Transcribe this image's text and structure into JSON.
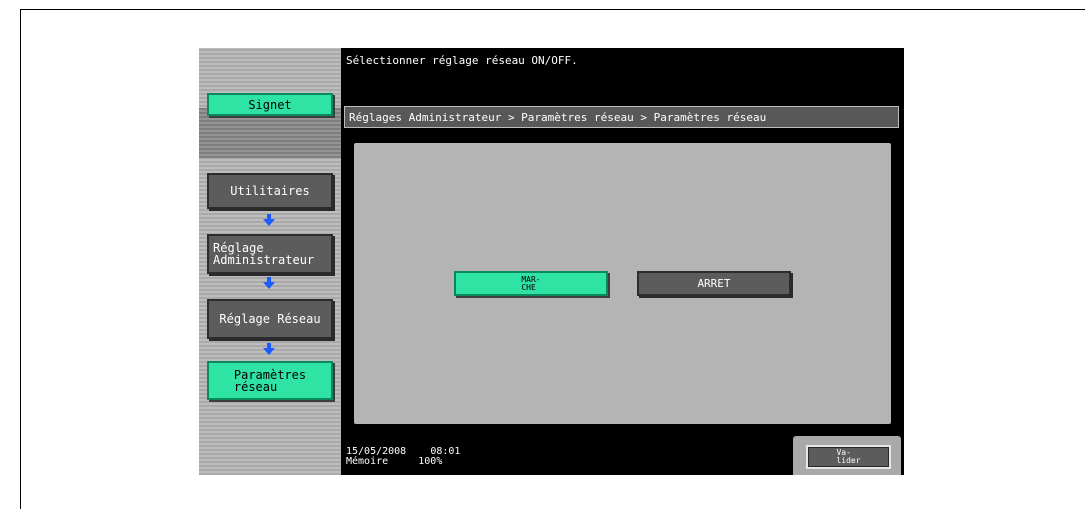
{
  "message": "Sélectionner réglage réseau ON/OFF.",
  "sidebar": {
    "bookmark_label": "Signet",
    "steps": [
      {
        "label": "Utilitaires",
        "active": false
      },
      {
        "label": "Réglage\nAdministrateur",
        "active": false
      },
      {
        "label": "Réglage Réseau",
        "active": false
      },
      {
        "label": "Paramètres\nréseau",
        "active": true
      }
    ]
  },
  "breadcrumb": "Réglages Administrateur > Paramètres réseau > Paramètres réseau",
  "options": {
    "on_label": "MAR-\nCHE",
    "off_label": "ARRET",
    "selected": "on"
  },
  "status": {
    "date": "15/05/2008",
    "time": "08:01",
    "memory_label": "Mémoire",
    "memory_value": "100%"
  },
  "valider_label": "Va-\nlider",
  "colors": {
    "selected": "#2fe3a5",
    "button": "#5c5c5c",
    "arrow": "#1a5cff"
  }
}
